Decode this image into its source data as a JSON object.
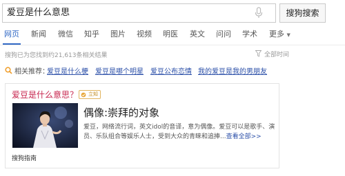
{
  "search": {
    "query": "爱豆是什么意思",
    "button_label": "搜狗搜索"
  },
  "tabs": [
    {
      "label": "网页",
      "active": true
    },
    {
      "label": "新闻"
    },
    {
      "label": "微信"
    },
    {
      "label": "知乎"
    },
    {
      "label": "图片"
    },
    {
      "label": "视频"
    },
    {
      "label": "明医"
    },
    {
      "label": "英文"
    },
    {
      "label": "问问"
    },
    {
      "label": "学术"
    },
    {
      "label": "更多"
    }
  ],
  "results": {
    "count_text": "搜狗已为您找到约21,613条相关结果",
    "time_filter": "全部时间"
  },
  "related": {
    "label": "相关推荐：",
    "links": [
      "爱豆是什么梗",
      "爱豆是哪个明星",
      "爱豆公布恋情",
      "我的爱豆是我的男朋友"
    ]
  },
  "card": {
    "title": "爱豆是什么意思？",
    "badge": "立知",
    "entry_title": "偶像:崇拜的对象",
    "entry_desc": "爱豆，网络流行词，英文idol的音译，意为偶像。爱豆可以是歌手、演员、乐队组合等娱乐人士，受到大众的青睐和追捧...",
    "see_all": "查看全部>>",
    "footer": "搜狗指南"
  },
  "colors": {
    "accent_blue": "#3068c5",
    "link_blue": "#2b4fa8",
    "title_red": "#c7254e",
    "badge_gold": "#c08a1e"
  }
}
